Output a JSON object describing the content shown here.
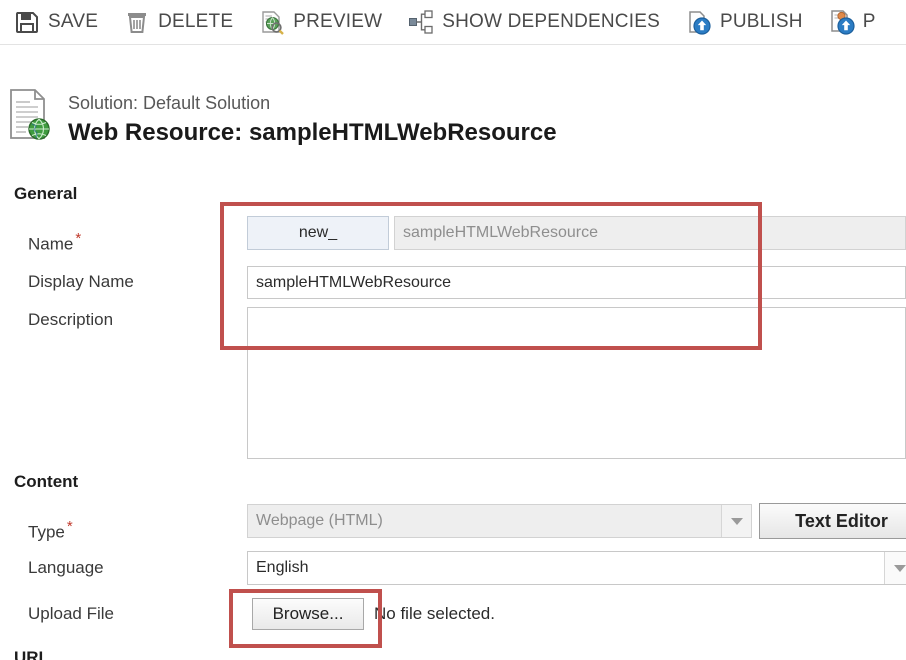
{
  "commandbar": {
    "items": [
      {
        "label": "SAVE",
        "icon": "save-icon"
      },
      {
        "label": "DELETE",
        "icon": "delete-trash-icon"
      },
      {
        "label": "PREVIEW",
        "icon": "preview-magnifier-icon"
      },
      {
        "label": "SHOW DEPENDENCIES",
        "icon": "show-dependencies-icon"
      },
      {
        "label": "PUBLISH",
        "icon": "publish-upload-icon"
      },
      {
        "label": "P",
        "icon": "publish-all-customizations-icon"
      }
    ]
  },
  "header": {
    "solution_line": "Solution: Default Solution",
    "record_title": "Web Resource: sampleHTMLWebResource",
    "icon": "web-resource-document-globe-icon"
  },
  "general": {
    "section_label": "General",
    "name": {
      "label": "Name",
      "required_marker": "*",
      "prefix_value": "new_",
      "value": "sampleHTMLWebResource"
    },
    "display_name": {
      "label": "Display Name",
      "value": "sampleHTMLWebResource"
    },
    "description": {
      "label": "Description",
      "value": ""
    }
  },
  "content": {
    "section_label": "Content",
    "type": {
      "label": "Type",
      "required_marker": "*",
      "value": "Webpage (HTML)"
    },
    "text_editor_button": "Text Editor",
    "language": {
      "label": "Language",
      "value": "English"
    },
    "upload_file": {
      "label": "Upload File",
      "browse_button": "Browse...",
      "file_status": "No file selected."
    }
  },
  "url_section": {
    "section_label": "URL"
  },
  "annotations": {
    "accent_color": "#c0504d",
    "boxes": [
      {
        "name": "name-fields-highlight"
      },
      {
        "name": "browse-button-highlight"
      }
    ]
  }
}
